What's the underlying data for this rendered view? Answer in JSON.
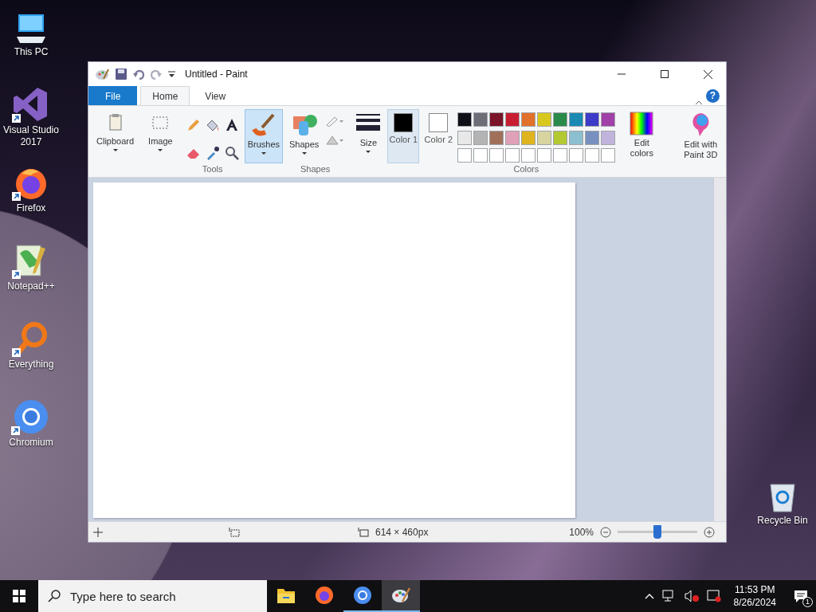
{
  "desktop_icons": [
    {
      "label": "This PC",
      "kind": "computer",
      "shortcut": false
    },
    {
      "label": "Visual Studio 2017",
      "kind": "visualstudio",
      "shortcut": true
    },
    {
      "label": "Firefox",
      "kind": "firefox",
      "shortcut": true
    },
    {
      "label": "Notepad++",
      "kind": "notepad",
      "shortcut": true
    },
    {
      "label": "Everything",
      "kind": "everything",
      "shortcut": true
    },
    {
      "label": "Chromium",
      "kind": "chromium",
      "shortcut": true
    }
  ],
  "recycle_bin": {
    "label": "Recycle Bin"
  },
  "paint_window": {
    "title": "Untitled - Paint",
    "help": "?",
    "tabs": [
      {
        "label": "File",
        "kind": "file",
        "selected": false
      },
      {
        "label": "Home",
        "kind": "tab",
        "selected": true
      },
      {
        "label": "View",
        "kind": "tab",
        "selected": false
      }
    ],
    "ribbon": {
      "clipboard": "Clipboard",
      "image": "Image",
      "tools_label": "Tools",
      "brushes": {
        "label": "Brushes",
        "selected": true
      },
      "shapes_button": "Shapes",
      "shapes_label": "Shapes",
      "size": "Size",
      "color_buttons": [
        {
          "label": "Color 1",
          "color": "#000000",
          "selected": true
        },
        {
          "label": "Color 2",
          "color": "#ffffff",
          "selected": false
        }
      ],
      "palette": [
        {
          "color": "#101018"
        },
        {
          "color": "#6e6e78"
        },
        {
          "color": "#7a1428"
        },
        {
          "color": "#c81e32"
        },
        {
          "color": "#e0702a"
        },
        {
          "color": "#d8c81e"
        },
        {
          "color": "#2a8a4a"
        },
        {
          "color": "#1a8ab4"
        },
        {
          "color": "#3c3cc8"
        },
        {
          "color": "#a040a8"
        },
        {
          "color": "#e8e8e8"
        },
        {
          "color": "#b4b4b4"
        },
        {
          "color": "#a0705a"
        },
        {
          "color": "#e0a0b8"
        },
        {
          "color": "#e0b41e"
        },
        {
          "color": "#d8d4a0"
        },
        {
          "color": "#b4c832"
        },
        {
          "color": "#8cc0d0"
        },
        {
          "color": "#7890c0"
        },
        {
          "color": "#c0b4dc"
        },
        {
          "color": "#ffffff"
        },
        {
          "color": "#ffffff"
        },
        {
          "color": "#ffffff"
        },
        {
          "color": "#ffffff"
        },
        {
          "color": "#ffffff"
        },
        {
          "color": "#ffffff"
        },
        {
          "color": "#ffffff"
        },
        {
          "color": "#ffffff"
        },
        {
          "color": "#ffffff"
        },
        {
          "color": "#ffffff"
        }
      ],
      "colors_label": "Colors",
      "edit_colors": "Edit colors",
      "paint3d": "Edit with Paint 3D"
    },
    "status_bar": {
      "size": "614 × 460px",
      "zoom": "100%",
      "level": 0.5
    }
  },
  "taskbar": {
    "search_placeholder": "Type here to search",
    "apps": [
      {
        "kind": "explorer",
        "running": false,
        "active": false
      },
      {
        "kind": "firefox",
        "running": false,
        "active": false
      },
      {
        "kind": "chromium",
        "running": true,
        "active": false
      },
      {
        "kind": "paint",
        "running": true,
        "active": true
      }
    ],
    "time": "11:53 PM",
    "date": "8/26/2024",
    "notifications": "1"
  }
}
